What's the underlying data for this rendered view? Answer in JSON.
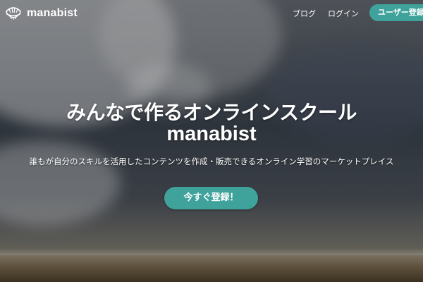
{
  "header": {
    "brand_name": "manabist",
    "logo_icon": "brain-logo-icon",
    "nav": [
      {
        "label": "ブログ"
      },
      {
        "label": "ログイン"
      }
    ],
    "register_label": "ユーザー登録"
  },
  "hero": {
    "headline": "みんなで作るオンラインスクール",
    "headline_sub": "manabist",
    "tagline": "誰もが自分のスキルを活用したコンテンツを作成・販売できるオンライン学習のマーケットプレイス",
    "cta_label": "今すぐ登録！"
  },
  "colors": {
    "accent": "#3fa39c",
    "text": "#ffffff"
  }
}
